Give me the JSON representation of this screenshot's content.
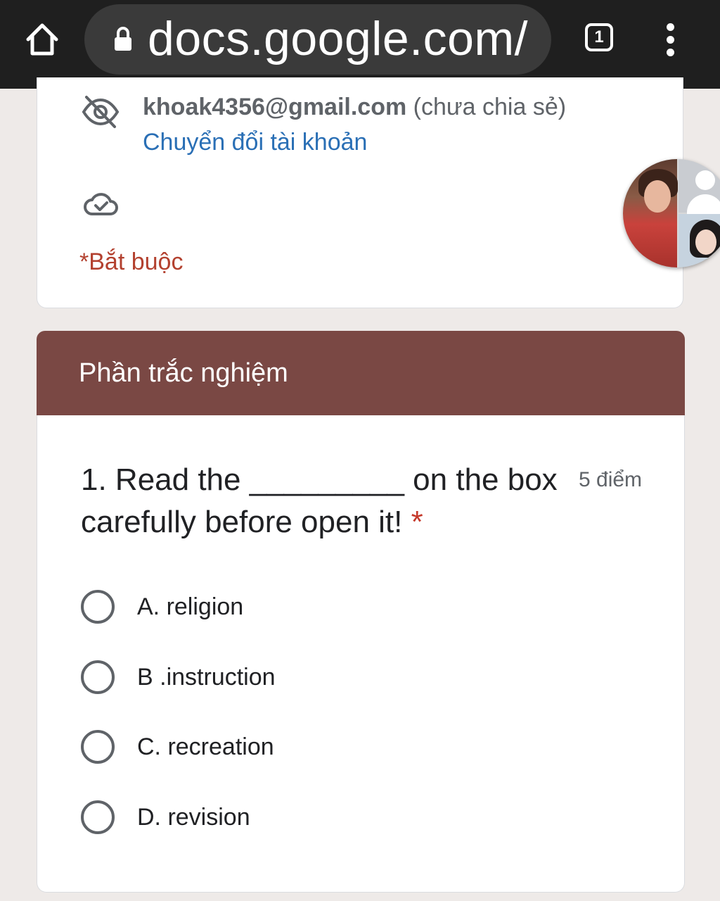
{
  "browser": {
    "url": "docs.google.com/",
    "tab_count": "1"
  },
  "account": {
    "email": "khoak4356@gmail.com",
    "share_status": "(chưa chia sẻ)",
    "switch_account": "Chuyển đổi tài khoản",
    "required_note": "*Bắt buộc"
  },
  "section": {
    "title": "Phần trắc nghiệm"
  },
  "question": {
    "text": "1. Read the _________ on the box carefully before open it!",
    "required_marker": "*",
    "points": "5 điểm",
    "options": [
      {
        "label": "A. religion"
      },
      {
        "label": "B .instruction"
      },
      {
        "label": "C. recreation"
      },
      {
        "label": "D. revision"
      }
    ]
  },
  "icons": {
    "home": "home-icon",
    "lock": "lock-icon",
    "tabs": "tabs-icon",
    "menu": "more-vert-icon",
    "visibility_off": "eye-off-icon",
    "cloud_saved": "cloud-done-icon"
  },
  "colors": {
    "section_header": "#7a4844",
    "required": "#b3412f",
    "link": "#2a6fb5",
    "topbar": "#1f1f1f"
  }
}
